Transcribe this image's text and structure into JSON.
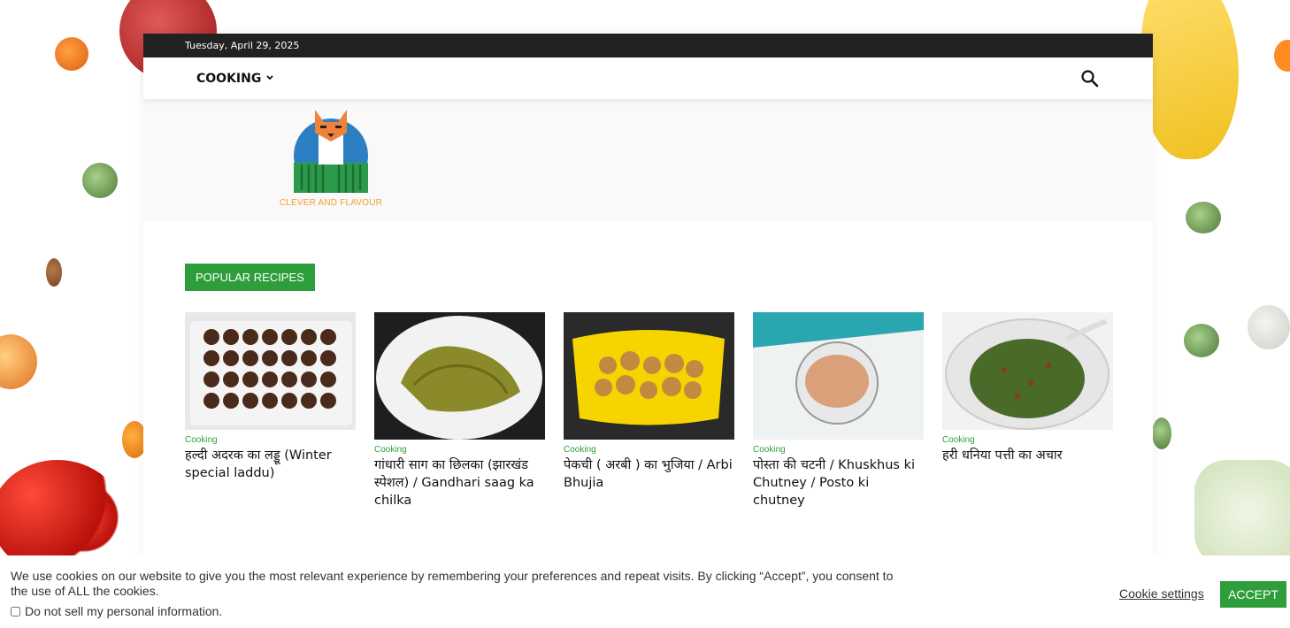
{
  "topbar": {
    "date": "Tuesday, April 29, 2025"
  },
  "nav": {
    "items": [
      {
        "label": "COOKING",
        "icon": "chevron-down-icon"
      }
    ],
    "search_icon": "search-icon"
  },
  "logo": {
    "text": "CLEVER AND FLAVOUR"
  },
  "section": {
    "title": "POPULAR RECIPES"
  },
  "recipes": [
    {
      "category": "Cooking",
      "title": "हल्दी अदरक का लड्डू (Winter special laddu)"
    },
    {
      "category": "Cooking",
      "title": "गांधारी साग का छिलका (झारखंड स्पेशल) / Gandhari saag ka chilka"
    },
    {
      "category": "Cooking",
      "title": "पेकची ( अरबी ) का भुजिया / Arbi Bhujia"
    },
    {
      "category": "Cooking",
      "title": "पोस्ता की चटनी / Khuskhus ki Chutney / Posto ki chutney"
    },
    {
      "category": "Cooking",
      "title": "हरी धनिया पत्ती का अचार"
    }
  ],
  "cookie": {
    "text": "We use cookies on our website to give you the most relevant experience by remembering your preferences and repeat visits. By clicking “Accept”, you consent to the use of ALL the cookies.",
    "do_not_sell": "Do not sell my personal information.",
    "settings": "Cookie settings",
    "accept": "ACCEPT"
  },
  "colors": {
    "accent": "#2e9e3a",
    "topbar": "#222222",
    "logo_text": "#f0a030"
  }
}
